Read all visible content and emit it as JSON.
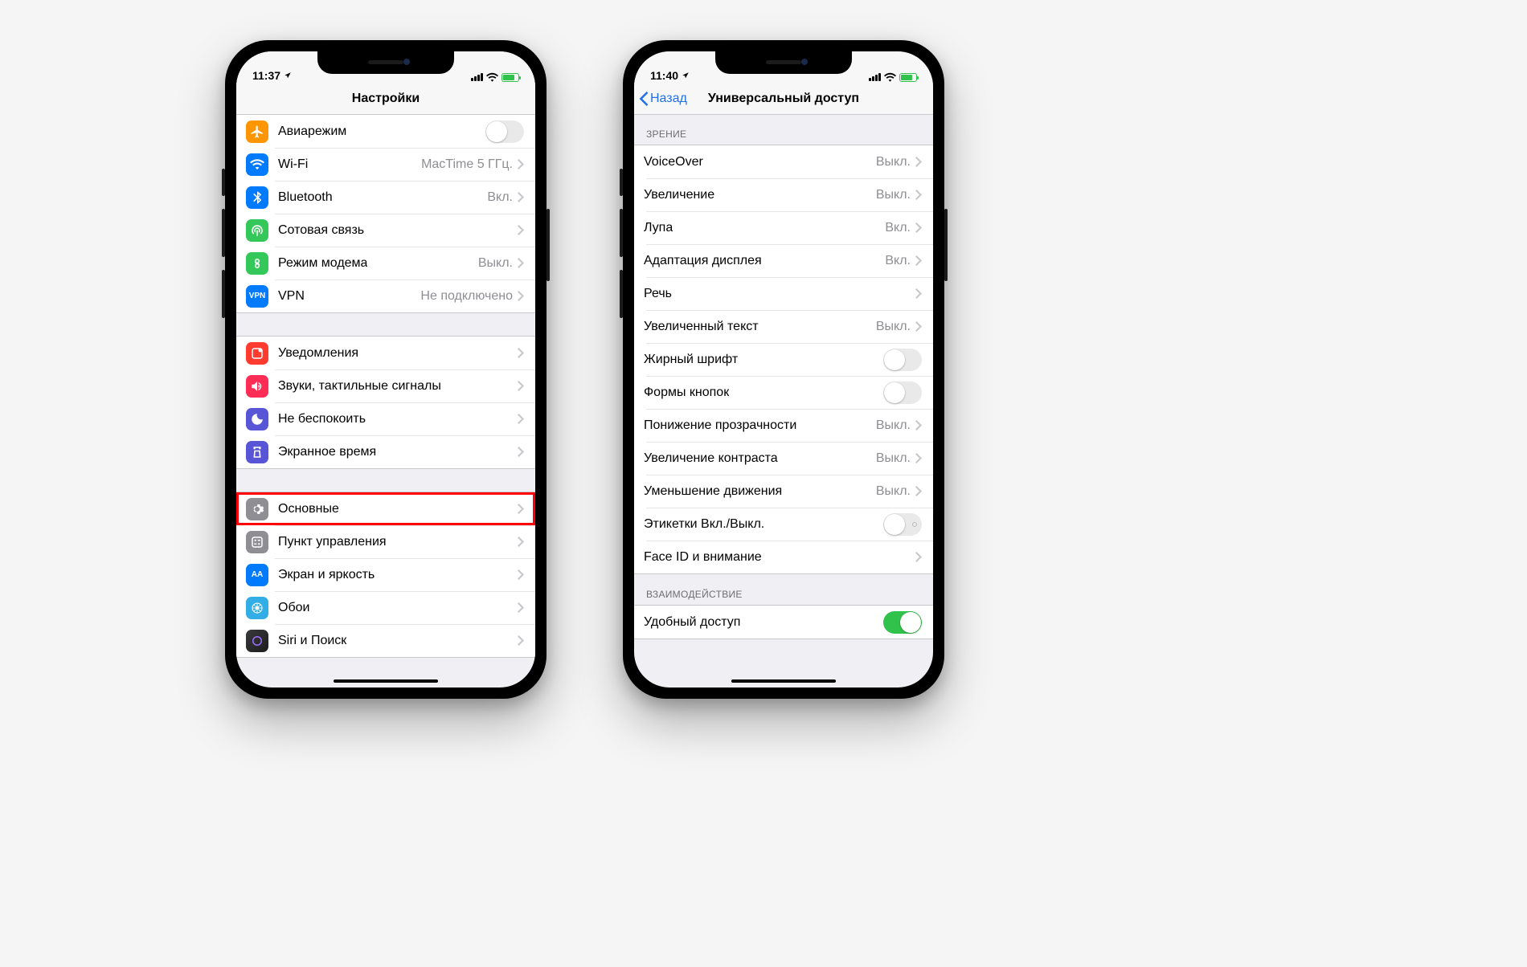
{
  "phones": {
    "left": {
      "status": {
        "time": "11:37"
      },
      "nav": {
        "title": "Настройки",
        "back": null
      },
      "groups": [
        {
          "items": [
            {
              "key": "airplane",
              "label": "Авиарежим",
              "kind": "toggle",
              "on": false,
              "iconColor": "bg-orange"
            },
            {
              "key": "wifi",
              "label": "Wi-Fi",
              "value": "MacTime 5 ГГц.",
              "kind": "link",
              "iconColor": "bg-blue"
            },
            {
              "key": "bluetooth",
              "label": "Bluetooth",
              "value": "Вкл.",
              "kind": "link",
              "iconColor": "bg-blue"
            },
            {
              "key": "cellular",
              "label": "Сотовая связь",
              "kind": "link",
              "iconColor": "bg-green"
            },
            {
              "key": "hotspot",
              "label": "Режим модема",
              "value": "Выкл.",
              "kind": "link",
              "iconColor": "bg-green"
            },
            {
              "key": "vpn",
              "label": "VPN",
              "value": "Не подключено",
              "kind": "link",
              "iconColor": "bg-blue",
              "iconText": "VPN"
            }
          ]
        },
        {
          "items": [
            {
              "key": "notifications",
              "label": "Уведомления",
              "kind": "link",
              "iconColor": "bg-red"
            },
            {
              "key": "sounds",
              "label": "Звуки, тактильные сигналы",
              "kind": "link",
              "iconColor": "bg-pink"
            },
            {
              "key": "dnd",
              "label": "Не беспокоить",
              "kind": "link",
              "iconColor": "bg-indigo"
            },
            {
              "key": "screentime",
              "label": "Экранное время",
              "kind": "link",
              "iconColor": "bg-indigo"
            }
          ]
        },
        {
          "items": [
            {
              "key": "general",
              "label": "Основные",
              "kind": "link",
              "iconColor": "bg-grey",
              "highlight": true
            },
            {
              "key": "controlcenter",
              "label": "Пункт управления",
              "kind": "link",
              "iconColor": "bg-grey"
            },
            {
              "key": "display",
              "label": "Экран и яркость",
              "kind": "link",
              "iconColor": "bg-dblue",
              "iconText": "AA"
            },
            {
              "key": "wallpaper",
              "label": "Обои",
              "kind": "link",
              "iconColor": "bg-cyan"
            },
            {
              "key": "siri",
              "label": "Siri и Поиск",
              "kind": "link",
              "iconColor": "bg-sltgrey"
            }
          ]
        }
      ]
    },
    "right": {
      "status": {
        "time": "11:40"
      },
      "nav": {
        "title": "Универсальный доступ",
        "back": "Назад"
      },
      "sections": [
        {
          "header": "ЗРЕНИЕ",
          "items": [
            {
              "key": "voiceover",
              "label": "VoiceOver",
              "value": "Выкл.",
              "kind": "link"
            },
            {
              "key": "zoom",
              "label": "Увеличение",
              "value": "Выкл.",
              "kind": "link"
            },
            {
              "key": "magnifier",
              "label": "Лупа",
              "value": "Вкл.",
              "kind": "link"
            },
            {
              "key": "displayaccom",
              "label": "Адаптация дисплея",
              "value": "Вкл.",
              "kind": "link"
            },
            {
              "key": "speech",
              "label": "Речь",
              "kind": "link"
            },
            {
              "key": "largetext",
              "label": "Увеличенный текст",
              "value": "Выкл.",
              "kind": "link"
            },
            {
              "key": "bold",
              "label": "Жирный шрифт",
              "kind": "toggle",
              "on": false
            },
            {
              "key": "buttonshapes",
              "label": "Формы кнопок",
              "kind": "toggle",
              "on": false
            },
            {
              "key": "reducetrans",
              "label": "Понижение прозрачности",
              "value": "Выкл.",
              "kind": "link"
            },
            {
              "key": "contrast",
              "label": "Увеличение контраста",
              "value": "Выкл.",
              "kind": "link"
            },
            {
              "key": "reducemotion",
              "label": "Уменьшение движения",
              "value": "Выкл.",
              "kind": "link"
            },
            {
              "key": "onofflabels",
              "label": "Этикетки Вкл./Выкл.",
              "kind": "toggle",
              "on": false,
              "labeled": true
            },
            {
              "key": "faceid",
              "label": "Face ID и внимание",
              "kind": "link"
            }
          ]
        },
        {
          "header": "ВЗАИМОДЕЙСТВИЕ",
          "items": [
            {
              "key": "reachability",
              "label": "Удобный доступ",
              "kind": "toggle",
              "on": true
            }
          ]
        }
      ]
    }
  }
}
